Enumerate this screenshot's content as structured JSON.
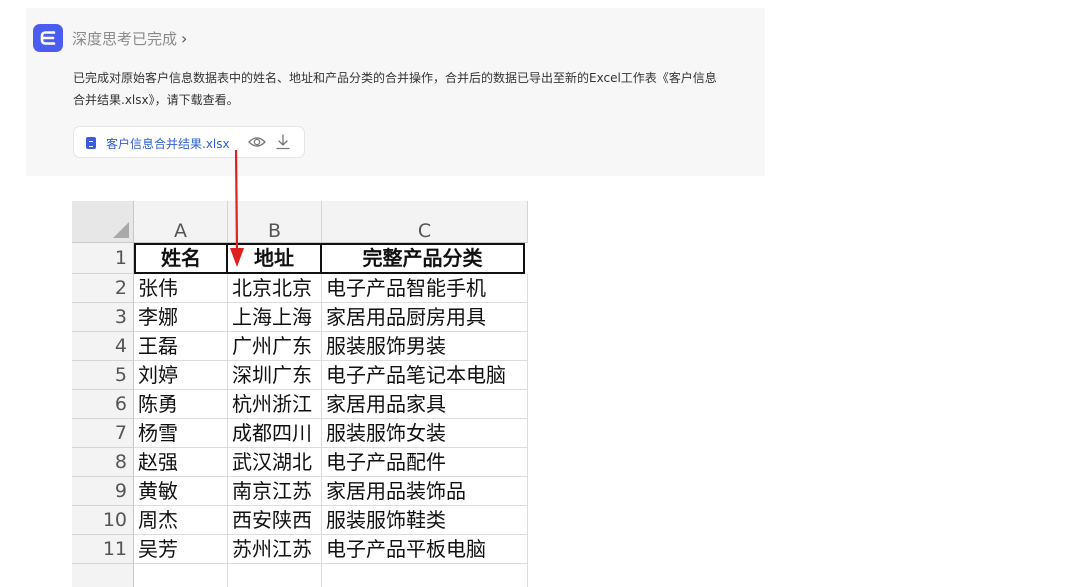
{
  "chat": {
    "thinking_label": "深度思考已完成",
    "thinking_chevron": "›",
    "message_line1": "已完成对原始客户信息数据表中的姓名、地址和产品分类的合并操作，合并后的数据已导出至新的Excel工作表《客户信息",
    "message_line2": "合并结果.xlsx》，请下载查看。",
    "file_name": "客户信息合并结果.xlsx",
    "icons": [
      "app-logo-icon",
      "file-icon",
      "eye-icon",
      "download-icon"
    ],
    "accent_color": "#4b5cf0"
  },
  "sheet": {
    "columns": [
      "A",
      "B",
      "C"
    ],
    "header": [
      "姓名",
      "地址",
      "完整产品分类"
    ],
    "rows": [
      {
        "num": "1"
      },
      {
        "num": "2",
        "name": "张伟",
        "addr": "北京北京",
        "cat": "电子产品智能手机"
      },
      {
        "num": "3",
        "name": "李娜",
        "addr": "上海上海",
        "cat": "家居用品厨房用具"
      },
      {
        "num": "4",
        "name": "王磊",
        "addr": "广州广东",
        "cat": "服装服饰男装"
      },
      {
        "num": "5",
        "name": "刘婷",
        "addr": "深圳广东",
        "cat": "电子产品笔记本电脑"
      },
      {
        "num": "6",
        "name": "陈勇",
        "addr": "杭州浙江",
        "cat": "家居用品家具"
      },
      {
        "num": "7",
        "name": "杨雪",
        "addr": "成都四川",
        "cat": "服装服饰女装"
      },
      {
        "num": "8",
        "name": "赵强",
        "addr": "武汉湖北",
        "cat": "电子产品配件"
      },
      {
        "num": "9",
        "name": "黄敏",
        "addr": "南京江苏",
        "cat": "家居用品装饰品"
      },
      {
        "num": "10",
        "name": "周杰",
        "addr": "西安陕西",
        "cat": "服装服饰鞋类"
      },
      {
        "num": "11",
        "name": "吴芳",
        "addr": "苏州江苏",
        "cat": "电子产品平板电脑"
      }
    ]
  },
  "annotation": {
    "arrow_color": "#e02020"
  }
}
